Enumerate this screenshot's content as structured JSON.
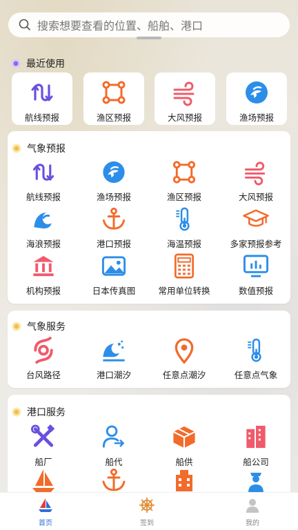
{
  "search": {
    "placeholder": "搜索想要查看的位置、船舶、港口"
  },
  "recent": {
    "title": "最近使用",
    "items": [
      {
        "label": "航线预报",
        "icon": "route-icon"
      },
      {
        "label": "渔区预报",
        "icon": "square-nodes-icon"
      },
      {
        "label": "大风预报",
        "icon": "wind-icon"
      },
      {
        "label": "渔场预报",
        "icon": "fish-icon"
      }
    ]
  },
  "weather_forecast": {
    "title": "气象预报",
    "items": [
      {
        "label": "航线预报",
        "icon": "route-icon"
      },
      {
        "label": "渔场预报",
        "icon": "fish-icon"
      },
      {
        "label": "渔区预报",
        "icon": "square-nodes-icon"
      },
      {
        "label": "大风预报",
        "icon": "wind-icon"
      },
      {
        "label": "海浪预报",
        "icon": "wave-icon"
      },
      {
        "label": "港口预报",
        "icon": "anchor-icon"
      },
      {
        "label": "海温预报",
        "icon": "thermometer-icon"
      },
      {
        "label": "多家预报参考",
        "icon": "graduation-cap-icon"
      },
      {
        "label": "机构预报",
        "icon": "institution-icon"
      },
      {
        "label": "日本传真图",
        "icon": "image-icon"
      },
      {
        "label": "常用单位转换",
        "icon": "calculator-icon"
      },
      {
        "label": "数值预报",
        "icon": "monitor-chart-icon"
      }
    ]
  },
  "weather_service": {
    "title": "气象服务",
    "items": [
      {
        "label": "台风路径",
        "icon": "typhoon-icon"
      },
      {
        "label": "港口潮汐",
        "icon": "tide-wave-icon"
      },
      {
        "label": "任意点潮汐",
        "icon": "location-pin-icon"
      },
      {
        "label": "任意点气象",
        "icon": "thermometer-icon"
      }
    ]
  },
  "port_service": {
    "title": "港口服务",
    "items": [
      {
        "label": "船厂",
        "icon": "tools-icon"
      },
      {
        "label": "船代",
        "icon": "agent-icon"
      },
      {
        "label": "船供",
        "icon": "supply-box-icon"
      },
      {
        "label": "船公司",
        "icon": "building-icon"
      },
      {
        "label": "",
        "icon": "sailboat-icon"
      },
      {
        "label": "",
        "icon": "anchor-icon"
      },
      {
        "label": "",
        "icon": "office-icon"
      },
      {
        "label": "",
        "icon": "officer-icon"
      }
    ]
  },
  "nav": {
    "items": [
      {
        "label": "首页",
        "icon": "sailboat-logo-icon",
        "active": true
      },
      {
        "label": "签到",
        "icon": "helm-wheel-icon",
        "active": false
      },
      {
        "label": "我的",
        "icon": "user-icon",
        "active": false
      }
    ]
  },
  "colors": {
    "purple": "#6a4fe0",
    "orange": "#f26b2a",
    "pink": "#f05a6b",
    "blue": "#2c8ee8",
    "active_nav": "#2c6fd6"
  }
}
